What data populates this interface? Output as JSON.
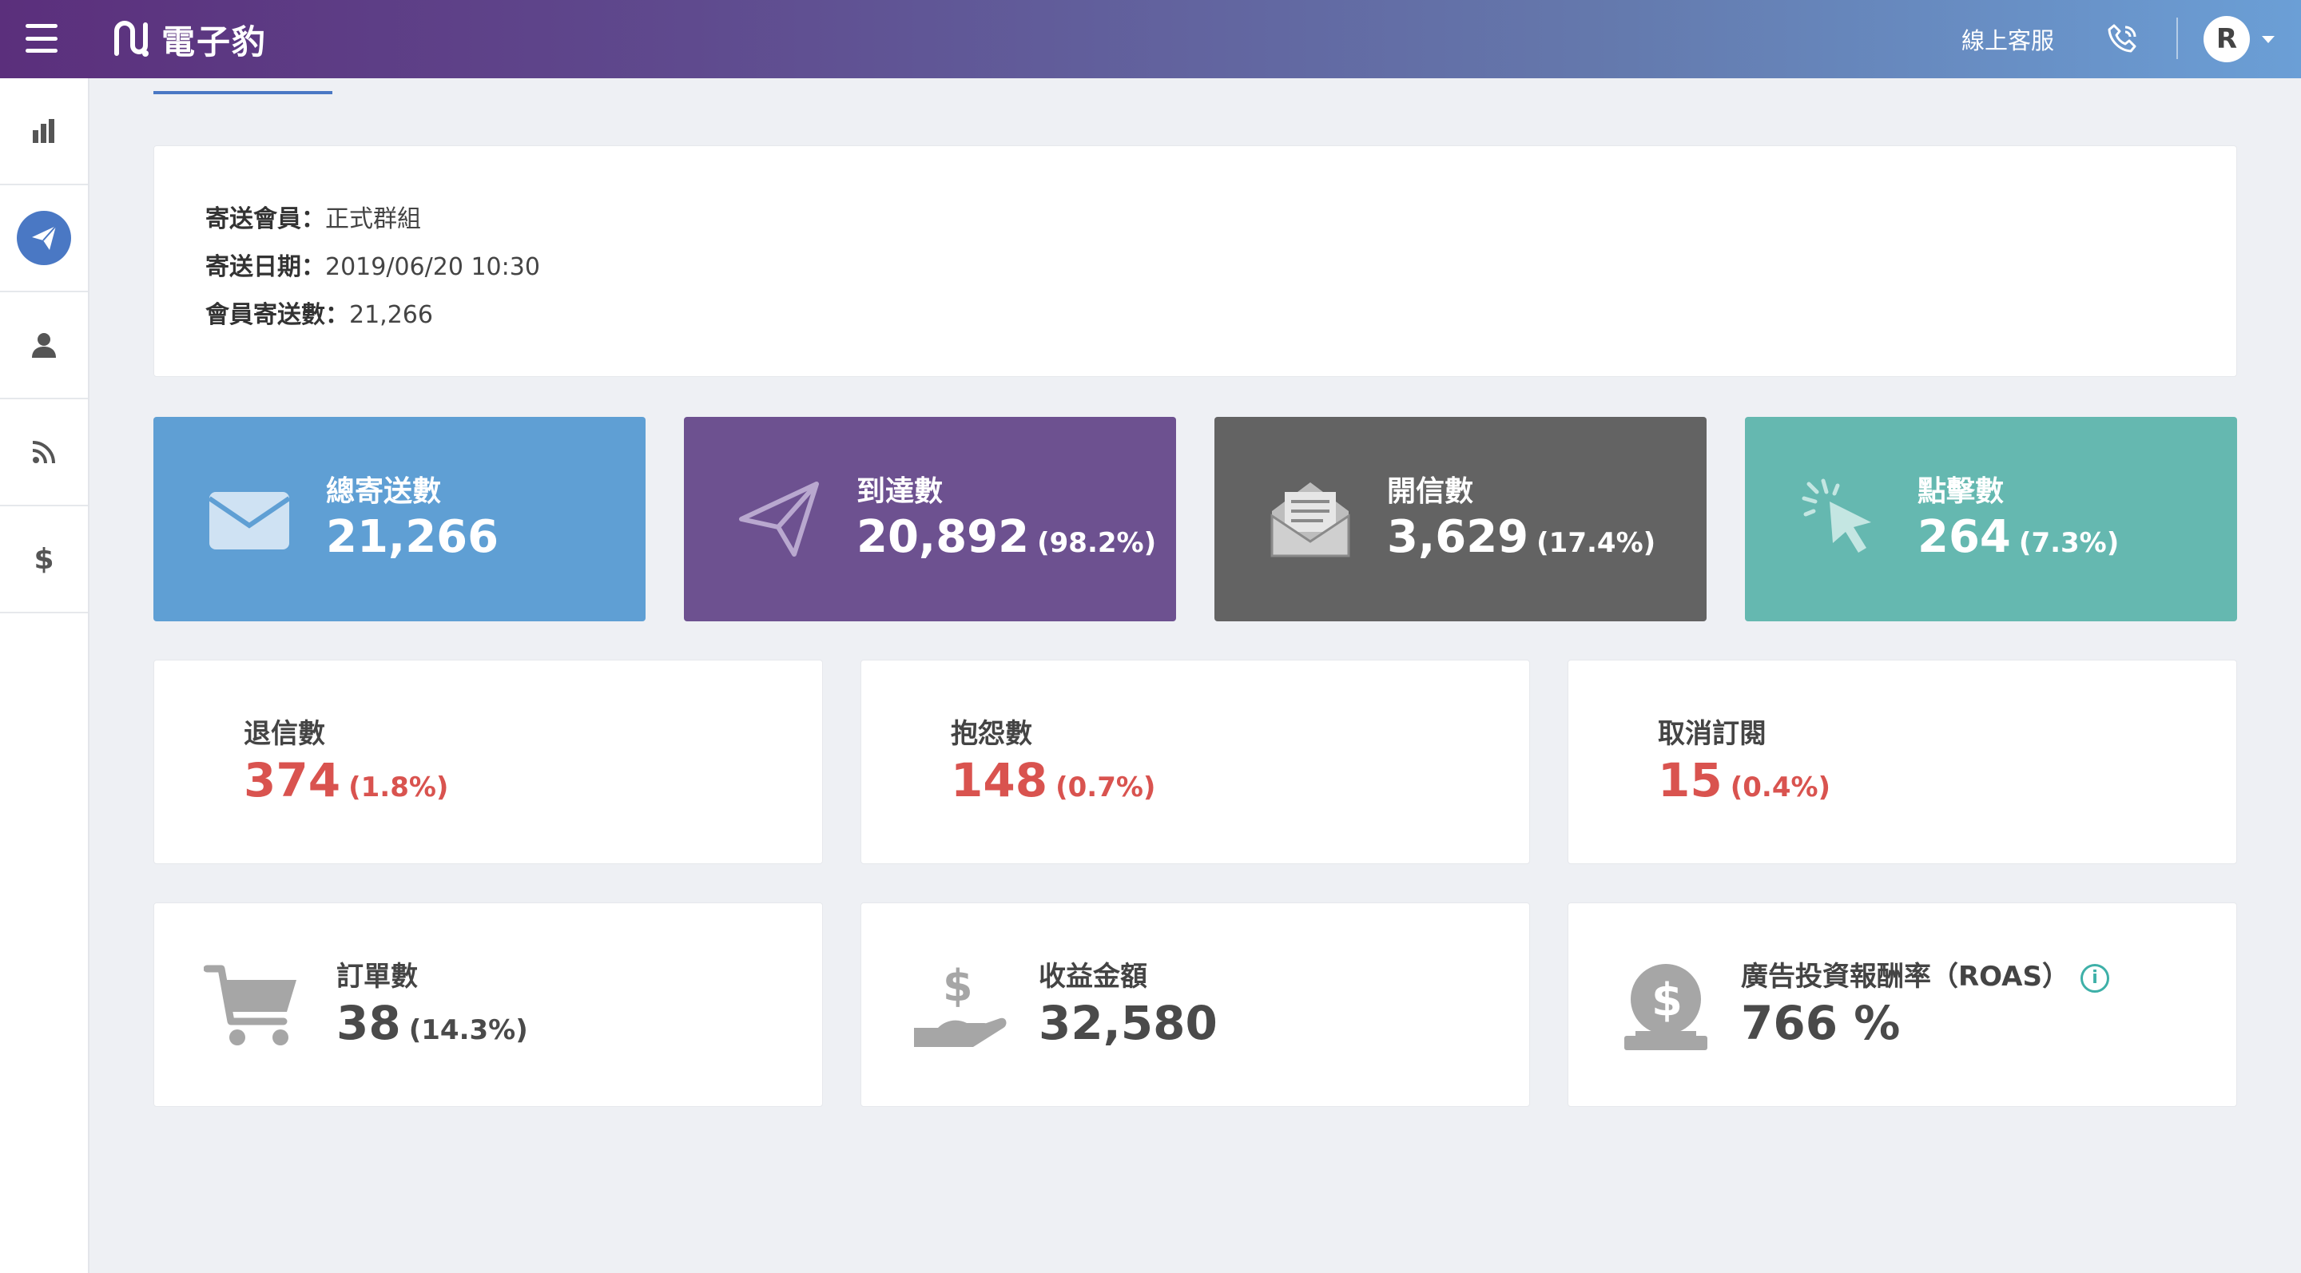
{
  "header": {
    "brand": "電子豹",
    "support_label": "線上客服",
    "avatar_initial": "R"
  },
  "sidebar": {
    "items": [
      {
        "name": "bar-chart-icon"
      },
      {
        "name": "paper-plane-icon",
        "active": true
      },
      {
        "name": "user-icon"
      },
      {
        "name": "rss-icon"
      },
      {
        "name": "dollar-icon",
        "glyph": "$"
      }
    ]
  },
  "send_info": {
    "members_label": "寄送會員：",
    "members_value": "正式群組",
    "date_label": "寄送日期：",
    "date_value": "2019/06/20 10:30",
    "count_label": "會員寄送數：",
    "count_value": "21,266"
  },
  "stats": {
    "total": {
      "label": "總寄送數",
      "value": "21,266",
      "color": "#5f9fd4",
      "icon": "envelope-icon"
    },
    "delivered": {
      "label": "到達數",
      "value": "20,892",
      "pct": "(98.2%)",
      "color": "#6d5190",
      "icon": "paper-plane-icon"
    },
    "opened": {
      "label": "開信數",
      "value": "3,629",
      "pct": "(17.4%)",
      "color": "#636363",
      "icon": "open-envelope-icon"
    },
    "clicked": {
      "label": "點擊數",
      "value": "264",
      "pct": "(7.3%)",
      "color": "#65b8b0",
      "icon": "cursor-click-icon"
    }
  },
  "issues": {
    "bounced": {
      "label": "退信數",
      "value": "374",
      "pct": "(1.8%)"
    },
    "complaints": {
      "label": "抱怨數",
      "value": "148",
      "pct": "(0.7%)"
    },
    "unsubscribed": {
      "label": "取消訂閱",
      "value": "15",
      "pct": "(0.4%)"
    }
  },
  "conversions": {
    "orders": {
      "label": "訂單數",
      "value": "38",
      "pct": "(14.3%)",
      "icon": "shopping-cart-icon"
    },
    "revenue": {
      "label": "收益金額",
      "value": "32,580",
      "icon": "hand-dollar-icon"
    },
    "roas": {
      "label": "廣告投資報酬率（ROAS）",
      "value": "766 %",
      "icon": "money-bag-icon",
      "info_glyph": "i"
    }
  },
  "colors": {
    "accent": "#4a78c4",
    "negative": "#d9534f",
    "info": "#3eb0a8"
  }
}
